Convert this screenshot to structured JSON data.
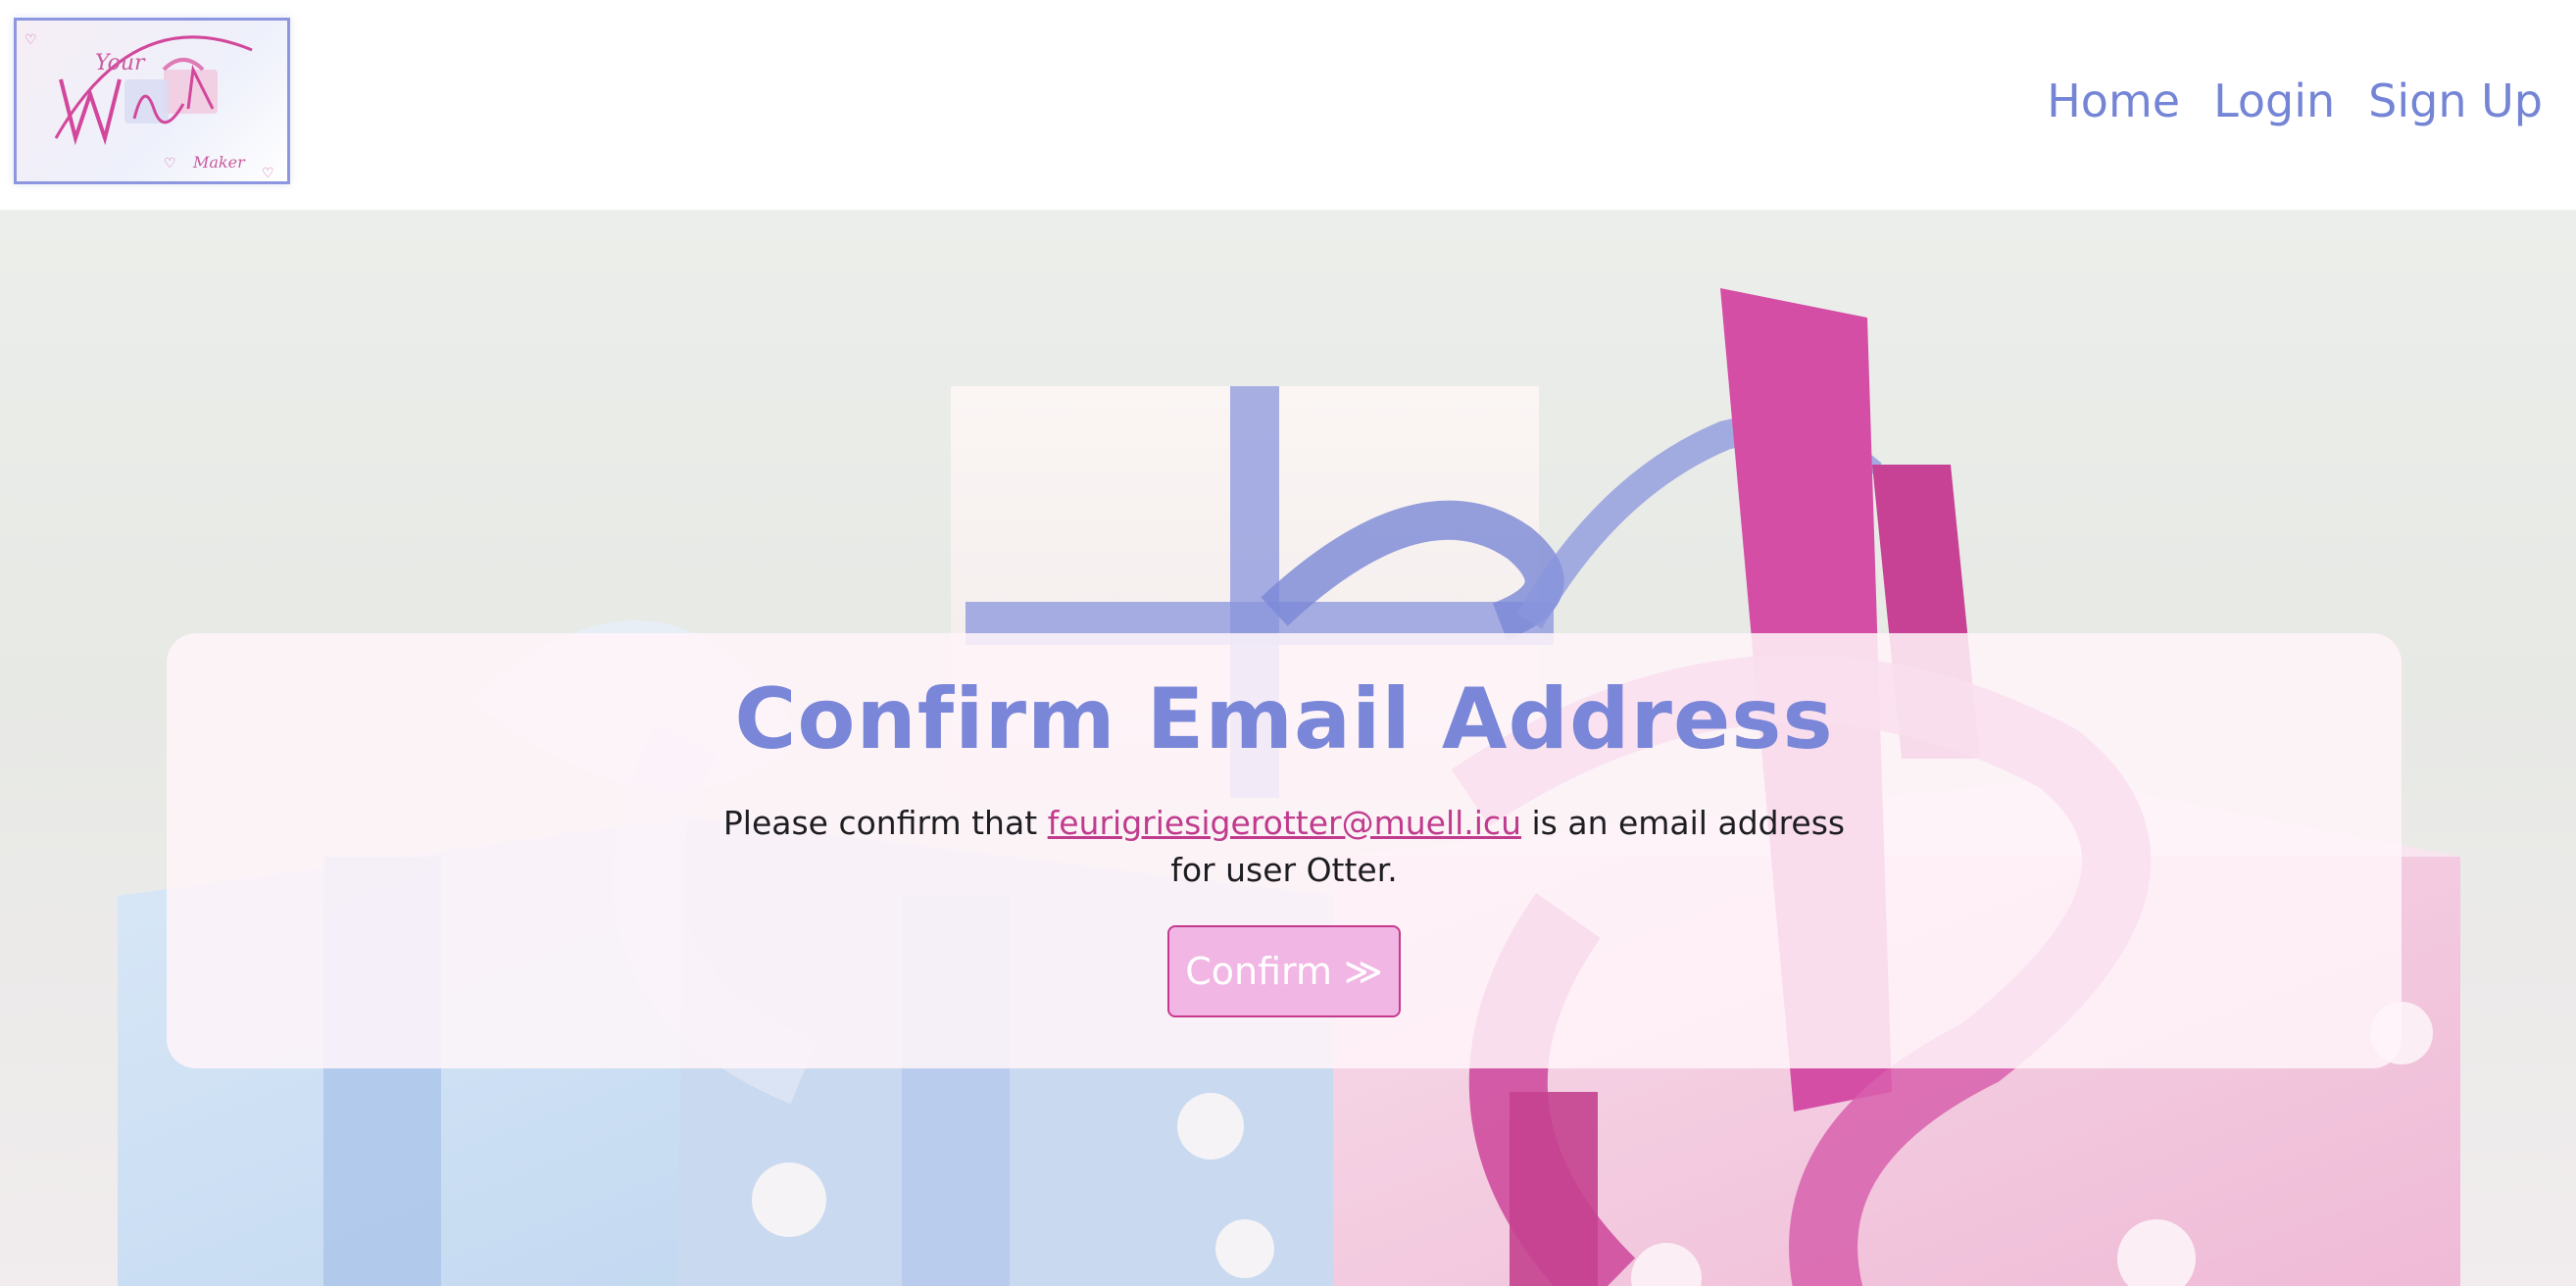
{
  "header": {
    "logo_alt": "Your Wish List Maker",
    "logo_text": {
      "top": "Your",
      "main": "Wish List",
      "bottom": "Maker"
    },
    "nav": [
      {
        "label": "Home"
      },
      {
        "label": "Login"
      },
      {
        "label": "Sign Up"
      }
    ]
  },
  "card": {
    "title": "Confirm Email Address",
    "text_before": "Please confirm that ",
    "email": "feurigriesigerotter@muell.icu",
    "text_after": " is an email address for user Otter.",
    "button_label": "Confirm",
    "button_icon": "double-chevron-right-icon"
  },
  "colors": {
    "nav_link": "#7585d6",
    "title": "#7a86d8",
    "email_link": "#c03b8d",
    "button_bg": "#f1b6e4",
    "button_border": "#c63a8e",
    "card_bg": "#fff4f9"
  }
}
